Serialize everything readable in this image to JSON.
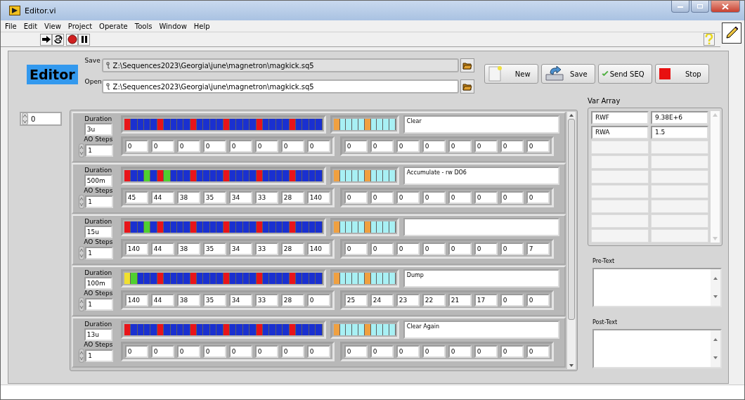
{
  "window": {
    "title": "Editor.vi"
  },
  "menu": [
    "File",
    "Edit",
    "View",
    "Project",
    "Operate",
    "Tools",
    "Window",
    "Help"
  ],
  "title_label": "Editor",
  "save": {
    "label": "Save",
    "path": "Z:\\Sequences2023\\Georgia\\june\\magnetron\\magkick.sq5"
  },
  "open": {
    "label": "Open",
    "path": "Z:\\Sequences2023\\Georgia\\june\\magnetron\\magkick.sq5"
  },
  "buttons": [
    {
      "label": "New",
      "kind": "new"
    },
    {
      "label": "Save",
      "kind": "save"
    },
    {
      "label": "Send SEQ",
      "kind": "send"
    },
    {
      "label": "Stop",
      "kind": "stop"
    }
  ],
  "index": "0",
  "steps": [
    {
      "duration_label": "Duration",
      "duration": "3u",
      "ao_label": "AO Steps",
      "ao_steps": "1",
      "comment": "Clear",
      "ao1": [
        "0",
        "0",
        "0",
        "0",
        "0",
        "0",
        "0",
        "0"
      ],
      "ao2": [
        "0",
        "0",
        "0",
        "0",
        "0",
        "0",
        "0",
        "0"
      ],
      "do": [
        {
          "color": "#e8141a"
        },
        {
          "color": "#1a30d0"
        },
        {
          "color": "#1a30d0"
        },
        {
          "color": "#1a30d0"
        },
        {
          "color": "#1a30d0"
        },
        {
          "color": "#e8141a"
        },
        {
          "color": "#1a30d0"
        },
        {
          "color": "#1a30d0"
        },
        {
          "color": "#1a30d0"
        },
        {
          "color": "#1a30d0"
        },
        {
          "color": "#e8141a"
        },
        {
          "color": "#1a30d0"
        },
        {
          "color": "#1a30d0"
        },
        {
          "color": "#1a30d0"
        },
        {
          "color": "#1a30d0"
        },
        {
          "color": "#e8141a"
        },
        {
          "color": "#1a30d0"
        },
        {
          "color": "#1a30d0"
        },
        {
          "color": "#1a30d0"
        },
        {
          "color": "#1a30d0"
        },
        {
          "color": "#e8141a"
        },
        {
          "color": "#1a30d0"
        },
        {
          "color": "#1a30d0"
        },
        {
          "color": "#1a30d0"
        },
        {
          "color": "#1a30d0"
        },
        {
          "color": "#e8141a"
        },
        {
          "color": "#1a30d0"
        },
        {
          "color": "#1a30d0"
        },
        {
          "color": "#1a30d0"
        },
        {
          "color": "#1a30d0"
        }
      ],
      "do2": [
        {
          "color": "#f0a040"
        },
        {
          "color": "#a8f0f4"
        },
        {
          "color": "#a8f0f4"
        },
        {
          "color": "#a8f0f4"
        },
        {
          "color": "#a8f0f4"
        },
        {
          "color": "#f0a040"
        },
        {
          "color": "#a8f0f4"
        },
        {
          "color": "#a8f0f4"
        },
        {
          "color": "#a8f0f4"
        },
        {
          "color": "#a8f0f4"
        }
      ]
    },
    {
      "duration_label": "Duration",
      "duration": "500m",
      "ao_label": "AO Steps",
      "ao_steps": "1",
      "comment": "Accumulate - rw DO6",
      "ao1": [
        "45",
        "44",
        "38",
        "35",
        "34",
        "33",
        "28",
        "140"
      ],
      "ao2": [
        "0",
        "0",
        "0",
        "0",
        "0",
        "0",
        "0",
        "0"
      ],
      "do": [
        {
          "color": "#e8141a"
        },
        {
          "color": "#1a30d0"
        },
        {
          "color": "#1a30d0"
        },
        {
          "color": "#50d030"
        },
        {
          "color": "#1a30d0"
        },
        {
          "color": "#e8141a"
        },
        {
          "color": "#50d030"
        },
        {
          "color": "#1a30d0"
        },
        {
          "color": "#1a30d0"
        },
        {
          "color": "#1a30d0"
        },
        {
          "color": "#e8141a"
        },
        {
          "color": "#1a30d0"
        },
        {
          "color": "#1a30d0"
        },
        {
          "color": "#1a30d0"
        },
        {
          "color": "#1a30d0"
        },
        {
          "color": "#e8141a"
        },
        {
          "color": "#1a30d0"
        },
        {
          "color": "#1a30d0"
        },
        {
          "color": "#1a30d0"
        },
        {
          "color": "#1a30d0"
        },
        {
          "color": "#e8141a"
        },
        {
          "color": "#1a30d0"
        },
        {
          "color": "#1a30d0"
        },
        {
          "color": "#1a30d0"
        },
        {
          "color": "#1a30d0"
        },
        {
          "color": "#e8141a"
        },
        {
          "color": "#1a30d0"
        },
        {
          "color": "#1a30d0"
        },
        {
          "color": "#1a30d0"
        },
        {
          "color": "#1a30d0"
        }
      ],
      "do2": [
        {
          "color": "#f0a040"
        },
        {
          "color": "#a8f0f4"
        },
        {
          "color": "#a8f0f4"
        },
        {
          "color": "#a8f0f4"
        },
        {
          "color": "#a8f0f4"
        },
        {
          "color": "#f0a040"
        },
        {
          "color": "#a8f0f4"
        },
        {
          "color": "#a8f0f4"
        },
        {
          "color": "#a8f0f4"
        },
        {
          "color": "#a8f0f4"
        }
      ]
    },
    {
      "duration_label": "Duration",
      "duration": "15u",
      "ao_label": "AO Steps",
      "ao_steps": "1",
      "ao1": [
        "140",
        "44",
        "38",
        "35",
        "34",
        "33",
        "28",
        "140"
      ],
      "ao2": [
        "0",
        "0",
        "0",
        "0",
        "0",
        "0",
        "0",
        "7"
      ],
      "do": [
        {
          "color": "#e8141a"
        },
        {
          "color": "#1a30d0"
        },
        {
          "color": "#1a30d0"
        },
        {
          "color": "#50d030"
        },
        {
          "color": "#1a30d0"
        },
        {
          "color": "#e8141a"
        },
        {
          "color": "#1a30d0"
        },
        {
          "color": "#1a30d0"
        },
        {
          "color": "#1a30d0"
        },
        {
          "color": "#1a30d0"
        },
        {
          "color": "#e8141a"
        },
        {
          "color": "#1a30d0"
        },
        {
          "color": "#1a30d0"
        },
        {
          "color": "#1a30d0"
        },
        {
          "color": "#1a30d0"
        },
        {
          "color": "#e8141a"
        },
        {
          "color": "#1a30d0"
        },
        {
          "color": "#1a30d0"
        },
        {
          "color": "#1a30d0"
        },
        {
          "color": "#1a30d0"
        },
        {
          "color": "#e8141a"
        },
        {
          "color": "#1a30d0"
        },
        {
          "color": "#1a30d0"
        },
        {
          "color": "#1a30d0"
        },
        {
          "color": "#1a30d0"
        },
        {
          "color": "#e8141a"
        },
        {
          "color": "#1a30d0"
        },
        {
          "color": "#1a30d0"
        },
        {
          "color": "#1a30d0"
        },
        {
          "color": "#1a30d0"
        }
      ],
      "do2": [
        {
          "color": "#f0a040"
        },
        {
          "color": "#a8f0f4"
        },
        {
          "color": "#a8f0f4"
        },
        {
          "color": "#a8f0f4"
        },
        {
          "color": "#a8f0f4"
        },
        {
          "color": "#f0a040"
        },
        {
          "color": "#a8f0f4"
        },
        {
          "color": "#a8f0f4"
        },
        {
          "color": "#a8f0f4"
        },
        {
          "color": "#a8f0f4"
        }
      ]
    },
    {
      "duration_label": "Duration",
      "duration": "100m",
      "ao_label": "AO Steps",
      "ao_steps": "1",
      "comment": "Dump",
      "ao1": [
        "140",
        "44",
        "38",
        "35",
        "34",
        "33",
        "28",
        "0"
      ],
      "ao2": [
        "25",
        "24",
        "23",
        "22",
        "21",
        "17",
        "0",
        "0"
      ],
      "do": [
        {
          "color": "#f0e030"
        },
        {
          "color": "#50d030"
        },
        {
          "color": "#1a30d0"
        },
        {
          "color": "#1a30d0"
        },
        {
          "color": "#1a30d0"
        },
        {
          "color": "#e8141a"
        },
        {
          "color": "#1a30d0"
        },
        {
          "color": "#1a30d0"
        },
        {
          "color": "#1a30d0"
        },
        {
          "color": "#1a30d0"
        },
        {
          "color": "#e8141a"
        },
        {
          "color": "#1a30d0"
        },
        {
          "color": "#1a30d0"
        },
        {
          "color": "#1a30d0"
        },
        {
          "color": "#1a30d0"
        },
        {
          "color": "#e8141a"
        },
        {
          "color": "#1a30d0"
        },
        {
          "color": "#1a30d0"
        },
        {
          "color": "#1a30d0"
        },
        {
          "color": "#1a30d0"
        },
        {
          "color": "#e8141a"
        },
        {
          "color": "#1a30d0"
        },
        {
          "color": "#1a30d0"
        },
        {
          "color": "#1a30d0"
        },
        {
          "color": "#1a30d0"
        },
        {
          "color": "#e8141a"
        },
        {
          "color": "#1a30d0"
        },
        {
          "color": "#1a30d0"
        },
        {
          "color": "#1a30d0"
        },
        {
          "color": "#1a30d0"
        }
      ],
      "do2": [
        {
          "color": "#f0a040"
        },
        {
          "color": "#a8f0f4"
        },
        {
          "color": "#a8f0f4"
        },
        {
          "color": "#a8f0f4"
        },
        {
          "color": "#a8f0f4"
        },
        {
          "color": "#f0a040"
        },
        {
          "color": "#a8f0f4"
        },
        {
          "color": "#a8f0f4"
        },
        {
          "color": "#a8f0f4"
        },
        {
          "color": "#a8f0f4"
        }
      ]
    },
    {
      "duration_label": "Duration",
      "duration": "13u",
      "ao_label": "AO Steps",
      "ao_steps": "1",
      "comment": "Clear Again",
      "ao1": [
        "0",
        "0",
        "0",
        "0",
        "0",
        "0",
        "0",
        "0"
      ],
      "ao2": [
        "0",
        "0",
        "0",
        "0",
        "0",
        "0",
        "0",
        "0"
      ],
      "do": [
        {
          "color": "#e8141a"
        },
        {
          "color": "#1a30d0"
        },
        {
          "color": "#1a30d0"
        },
        {
          "color": "#1a30d0"
        },
        {
          "color": "#1a30d0"
        },
        {
          "color": "#e8141a"
        },
        {
          "color": "#1a30d0"
        },
        {
          "color": "#1a30d0"
        },
        {
          "color": "#1a30d0"
        },
        {
          "color": "#1a30d0"
        },
        {
          "color": "#e8141a"
        },
        {
          "color": "#1a30d0"
        },
        {
          "color": "#1a30d0"
        },
        {
          "color": "#1a30d0"
        },
        {
          "color": "#1a30d0"
        },
        {
          "color": "#e8141a"
        },
        {
          "color": "#1a30d0"
        },
        {
          "color": "#1a30d0"
        },
        {
          "color": "#1a30d0"
        },
        {
          "color": "#1a30d0"
        },
        {
          "color": "#e8141a"
        },
        {
          "color": "#1a30d0"
        },
        {
          "color": "#1a30d0"
        },
        {
          "color": "#1a30d0"
        },
        {
          "color": "#1a30d0"
        },
        {
          "color": "#e8141a"
        },
        {
          "color": "#1a30d0"
        },
        {
          "color": "#1a30d0"
        },
        {
          "color": "#1a30d0"
        },
        {
          "color": "#1a30d0"
        }
      ],
      "do2": [
        {
          "color": "#f0a040"
        },
        {
          "color": "#a8f0f4"
        },
        {
          "color": "#a8f0f4"
        },
        {
          "color": "#a8f0f4"
        },
        {
          "color": "#a8f0f4"
        },
        {
          "color": "#f0a040"
        },
        {
          "color": "#a8f0f4"
        },
        {
          "color": "#a8f0f4"
        },
        {
          "color": "#a8f0f4"
        },
        {
          "color": "#a8f0f4"
        }
      ]
    }
  ],
  "var_array": {
    "label": "Var Array",
    "rows": [
      [
        "RWF",
        "9.38E+6"
      ],
      [
        "RWA",
        "1.5"
      ]
    ]
  },
  "pre_text": {
    "label": "Pre-Text"
  },
  "post_text": {
    "label": "Post-Text"
  }
}
